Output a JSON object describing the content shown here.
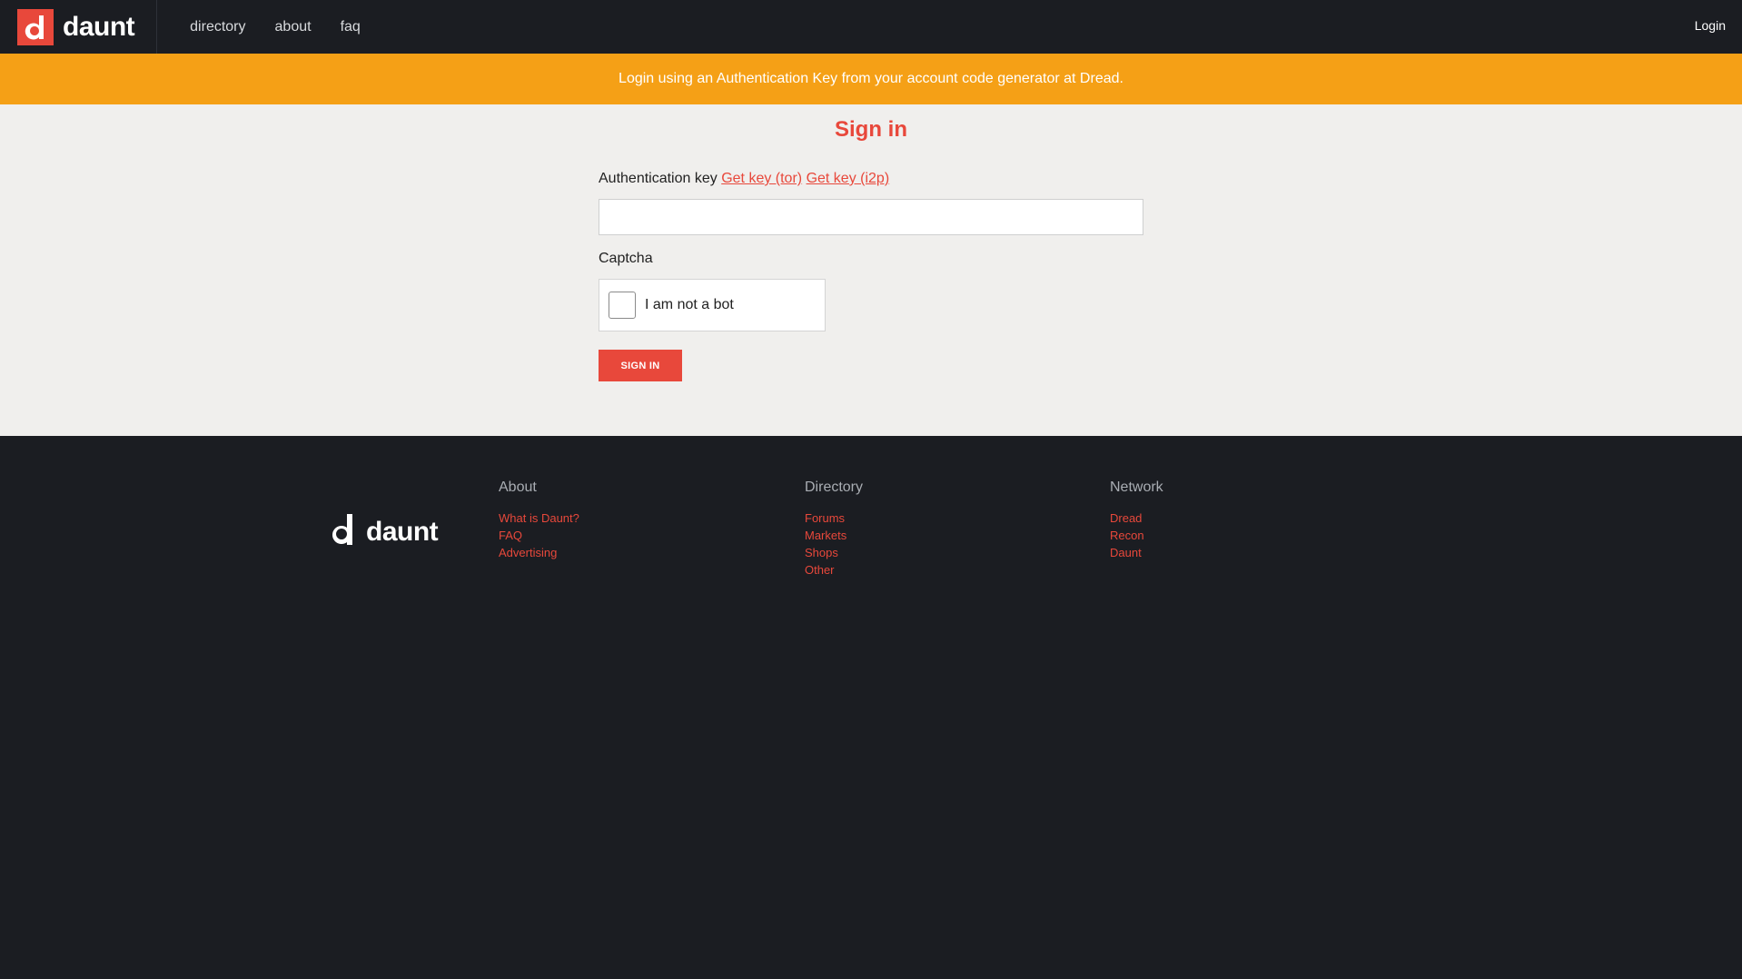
{
  "nav": {
    "brand": "daunt",
    "links": [
      "directory",
      "about",
      "faq"
    ],
    "login": "Login"
  },
  "alert": {
    "text": "Login using an Authentication Key from your account code generator at Dread."
  },
  "signin": {
    "title": "Sign in",
    "auth_label": "Authentication key",
    "get_key_tor": "Get key (tor)",
    "get_key_i2p": "Get key (i2p)",
    "auth_value": "",
    "captcha_label": "Captcha",
    "captcha_text": "I am not a bot",
    "button": "SIGN IN"
  },
  "footer": {
    "brand": "daunt",
    "columns": [
      {
        "title": "About",
        "links": [
          "What is Daunt?",
          "FAQ",
          "Advertising"
        ]
      },
      {
        "title": "Directory",
        "links": [
          "Forums",
          "Markets",
          "Shops",
          "Other"
        ]
      },
      {
        "title": "Network",
        "links": [
          "Dread",
          "Recon",
          "Daunt"
        ]
      }
    ]
  },
  "colors": {
    "accent": "#e8483b",
    "alert": "#f5a016",
    "dark": "#1b1d22",
    "main_bg": "#f0efed"
  }
}
